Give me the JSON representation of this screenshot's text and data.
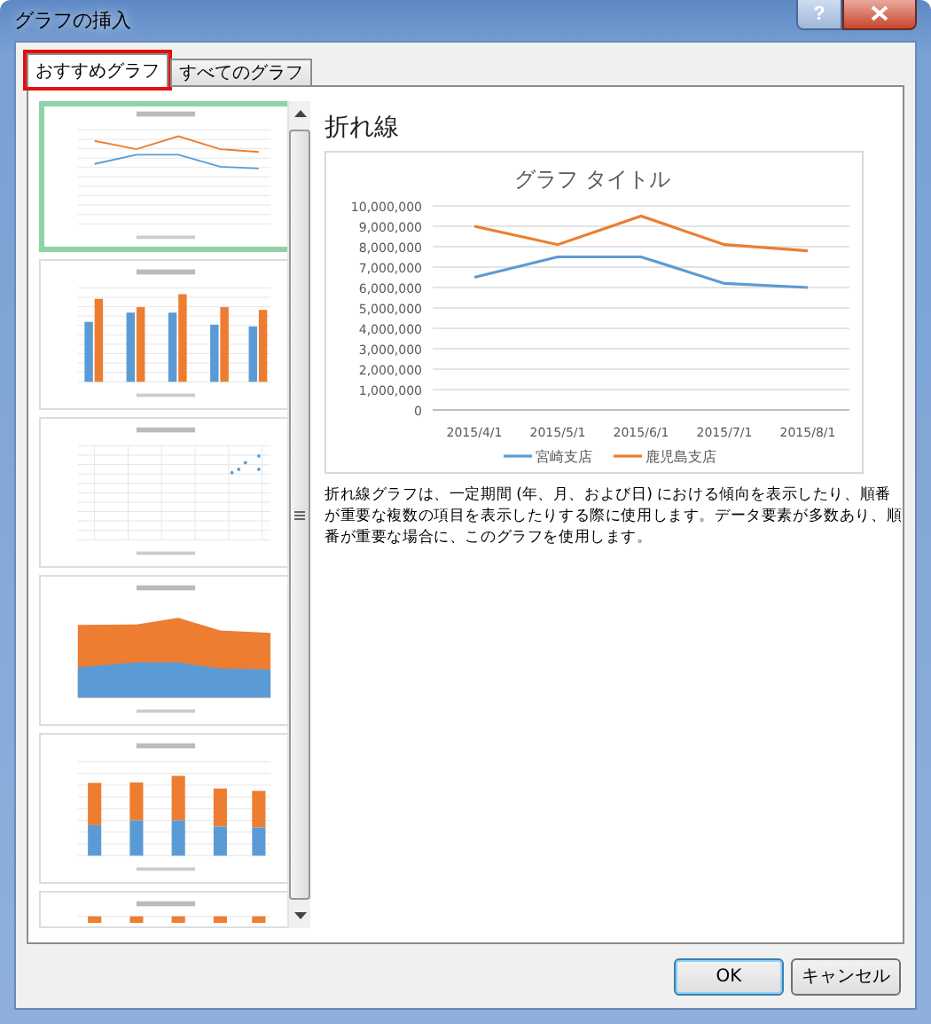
{
  "window": {
    "title": "グラフの挿入",
    "help": "?"
  },
  "tabs": [
    {
      "label": "おすすめグラフ",
      "selected": true,
      "highlighted": true
    },
    {
      "label": "すべてのグラフ",
      "selected": false,
      "highlighted": false
    }
  ],
  "thumbnails": [
    {
      "kind": "line",
      "selected": true
    },
    {
      "kind": "column",
      "selected": false
    },
    {
      "kind": "scatter",
      "selected": false
    },
    {
      "kind": "area",
      "selected": false
    },
    {
      "kind": "stacked",
      "selected": false
    },
    {
      "kind": "percent",
      "selected": false
    }
  ],
  "preview": {
    "heading": "折れ線",
    "chart_data": {
      "type": "line",
      "title": "グラフ タイトル",
      "categories": [
        "2015/4/1",
        "2015/5/1",
        "2015/6/1",
        "2015/7/1",
        "2015/8/1"
      ],
      "series": [
        {
          "name": "宮崎支店",
          "color": "#5b9bd5",
          "values": [
            6500000,
            7500000,
            7500000,
            6200000,
            6000000
          ]
        },
        {
          "name": "鹿児島支店",
          "color": "#ed7d31",
          "values": [
            9000000,
            8100000,
            9500000,
            8100000,
            7800000
          ]
        }
      ],
      "grid": true,
      "legend": "bottom",
      "ylim": [
        0,
        10000000
      ],
      "yticks": [
        {
          "value": 0,
          "label": "0"
        },
        {
          "value": 1000000,
          "label": "1,000,000"
        },
        {
          "value": 2000000,
          "label": "2,000,000"
        },
        {
          "value": 3000000,
          "label": "3,000,000"
        },
        {
          "value": 4000000,
          "label": "4,000,000"
        },
        {
          "value": 5000000,
          "label": "5,000,000"
        },
        {
          "value": 6000000,
          "label": "6,000,000"
        },
        {
          "value": 7000000,
          "label": "7,000,000"
        },
        {
          "value": 8000000,
          "label": "8,000,000"
        },
        {
          "value": 9000000,
          "label": "9,000,000"
        },
        {
          "value": 10000000,
          "label": "10,000,000"
        }
      ]
    },
    "description": "折れ線グラフは、一定期間 (年、月、および日) における傾向を表示したり、順番が重要な複数の項目を表示したりする際に使用します。データ要素が多数あり、順番が重要な場合に、このグラフを使用します。"
  },
  "buttons": [
    {
      "label": "OK",
      "default": true
    },
    {
      "label": "キャンセル",
      "default": false
    }
  ]
}
